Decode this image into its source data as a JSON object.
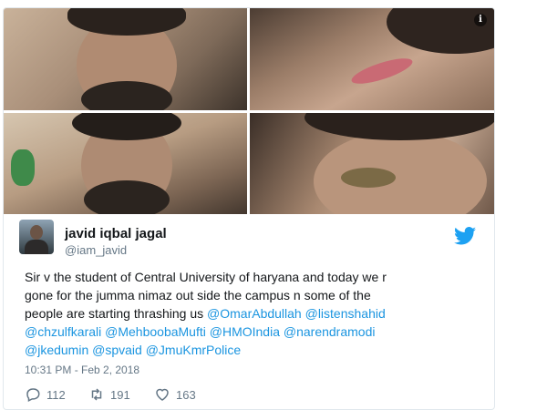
{
  "tweet": {
    "author_name": "javid iqbal jagal",
    "author_handle": "@iam_javid",
    "text_lines": [
      [
        {
          "t": "Sir v the student of Central University of haryana and today we r",
          "m": false
        }
      ],
      [
        {
          "t": "gone for the jumma nimaz  out side the campus n some of the",
          "m": false
        }
      ],
      [
        {
          "t": "people are starting thrashing us ",
          "m": false
        },
        {
          "t": "@OmarAbdullah",
          "m": true
        },
        {
          "t": " ",
          "m": false
        },
        {
          "t": "@listenshahid",
          "m": true
        }
      ],
      [
        {
          "t": "@chzulfkarali",
          "m": true
        },
        {
          "t": " ",
          "m": false
        },
        {
          "t": "@MehboobaMufti",
          "m": true
        },
        {
          "t": " ",
          "m": false
        },
        {
          "t": "@HMOIndia",
          "m": true
        },
        {
          "t": " ",
          "m": false
        },
        {
          "t": "@narendramodi",
          "m": true
        }
      ],
      [
        {
          "t": "@jkedumin",
          "m": true
        },
        {
          "t": " ",
          "m": false
        },
        {
          "t": "@spvaid",
          "m": true
        },
        {
          "t": " ",
          "m": false
        },
        {
          "t": "@JmuKmrPolice",
          "m": true
        }
      ]
    ],
    "timestamp": "10:31 PM - Feb 2, 2018",
    "replies": "112",
    "retweets": "191",
    "likes": "163",
    "info_glyph": "i"
  },
  "icons": {
    "info": "info-icon",
    "twitter": "twitter-bird-icon",
    "reply": "reply-icon",
    "retweet": "retweet-icon",
    "like": "heart-icon"
  },
  "colors": {
    "mention": "#1b95e0",
    "twitter_blue": "#1da1f2",
    "muted": "#657786",
    "text": "#14171a"
  }
}
